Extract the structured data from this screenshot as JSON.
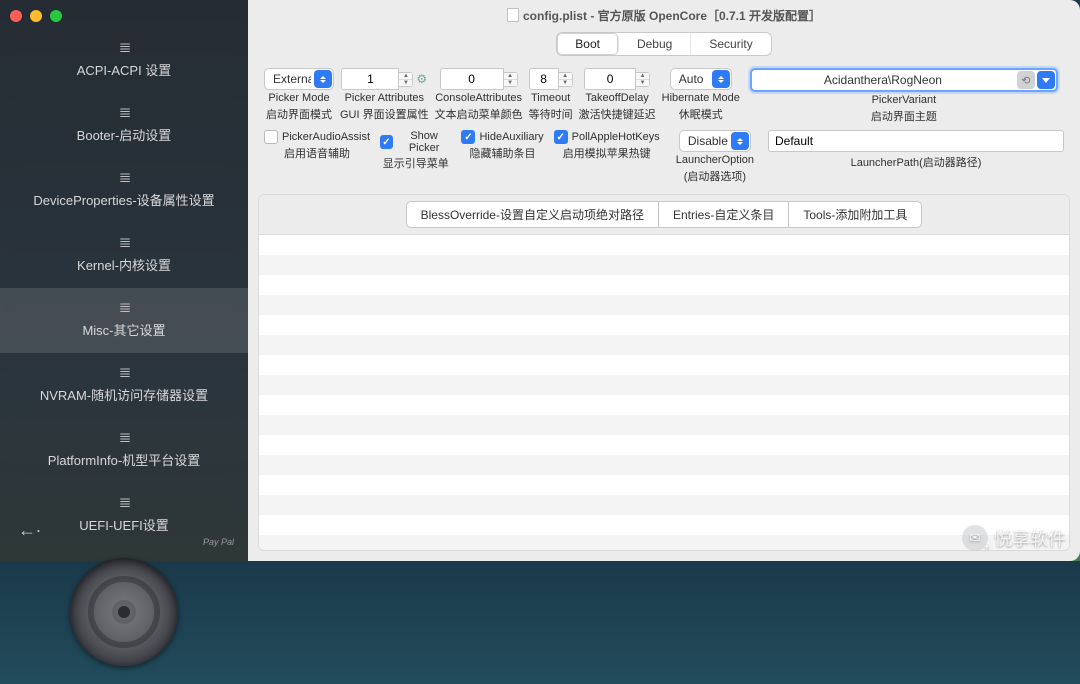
{
  "window_title": "config.plist - 官方原版 OpenCore［0.7.1 开发版配置］",
  "sidebar": {
    "items": [
      {
        "label": "ACPI-ACPI 设置"
      },
      {
        "label": "Booter-启动设置"
      },
      {
        "label": "DeviceProperties-设备属性设置"
      },
      {
        "label": "Kernel-内核设置"
      },
      {
        "label": "Misc-其它设置"
      },
      {
        "label": "NVRAM-随机访问存储器设置"
      },
      {
        "label": "PlatformInfo-机型平台设置"
      },
      {
        "label": "UEFI-UEFI设置"
      }
    ],
    "active_index": 4,
    "paypal": "Pay\nPal"
  },
  "tabs": {
    "boot": "Boot",
    "debug": "Debug",
    "security": "Security",
    "active": "boot"
  },
  "fields": {
    "picker_mode": {
      "value": "External",
      "en": "Picker Mode",
      "cn": "启动界面模式"
    },
    "picker_attributes": {
      "value": "1",
      "en": "Picker Attributes",
      "cn": "GUI 界面设置属性"
    },
    "console_attributes": {
      "value": "0",
      "en": "ConsoleAttributes",
      "cn": "文本启动菜单颜色"
    },
    "timeout": {
      "value": "8",
      "en": "Timeout",
      "cn": "等待时间"
    },
    "takeoff_delay": {
      "value": "0",
      "en": "TakeoffDelay",
      "cn": "激活快捷键延迟"
    },
    "hibernate_mode": {
      "value": "Auto",
      "en": "Hibernate Mode",
      "cn": "休眠模式"
    },
    "picker_variant": {
      "value": "Acidanthera\\RogNeon",
      "en": "PickerVariant",
      "cn": "启动界面主题"
    },
    "launcher_option": {
      "value": "Disabled",
      "en": "LauncherOption",
      "cn": "(启动器选项)"
    },
    "launcher_path": {
      "value": "Default",
      "en": "LauncherPath(启动器路径)"
    }
  },
  "checks": {
    "picker_audio": {
      "checked": false,
      "en": "PickerAudioAssist",
      "cn": "启用语音辅助"
    },
    "show_picker": {
      "checked": true,
      "en": "Show Picker",
      "cn": "显示引导菜单"
    },
    "hide_aux": {
      "checked": true,
      "en": "HideAuxiliary",
      "cn": "隐藏辅助条目"
    },
    "poll_hotkeys": {
      "checked": true,
      "en": "PollAppleHotKeys",
      "cn": "启用模拟苹果热键"
    }
  },
  "subtabs": {
    "bless": "BlessOverride-设置自定义启动项绝对路径",
    "entries": "Entries-自定义条目",
    "tools": "Tools-添加附加工具",
    "active": "bless"
  },
  "watermark": "悦享软件"
}
